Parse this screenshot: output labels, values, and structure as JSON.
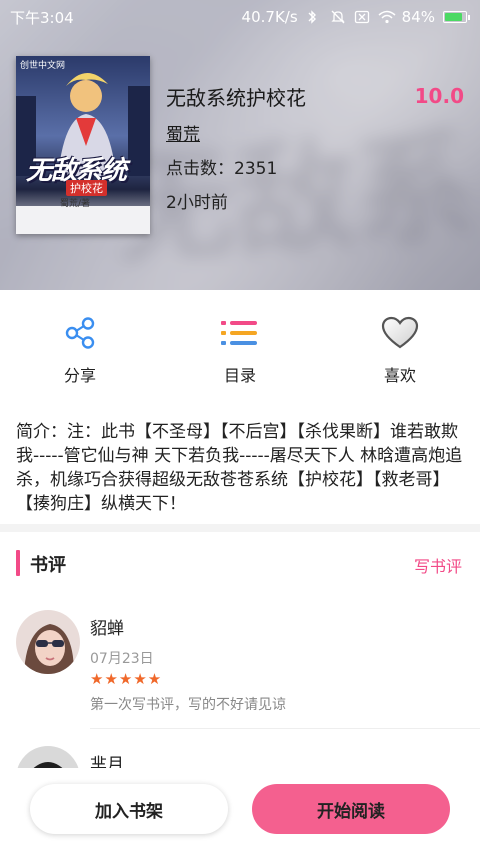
{
  "status_bar": {
    "time": "下午3:04",
    "speed": "40.7K/s",
    "battery": "84%"
  },
  "book": {
    "cover_brand": "创世中文网",
    "cover_title": "无敌系统",
    "cover_subtitle": "护校花",
    "cover_author": "蜀荒/著",
    "title": "无敌系统护校花",
    "score": "10.0",
    "author": "蜀荒",
    "clicks": "点击数：2351",
    "updated": "2小时前"
  },
  "actions": [
    {
      "label": "分享",
      "icon": "share-icon"
    },
    {
      "label": "目录",
      "icon": "catalog-icon"
    },
    {
      "label": "喜欢",
      "icon": "heart-icon"
    }
  ],
  "intro": "简介：注：此书【不圣母】【不后宫】【杀伐果断】谁若敢欺我-----管它仙与神 天下若负我-----屠尽天下人 林晗遭高炮追杀，机缘巧合获得超级无敌苍苍系统【护校花】【救老哥】【揍狗庄】纵横天下！",
  "reviews": {
    "title": "书评",
    "write_label": "写书评",
    "items": [
      {
        "name": "貂蝉",
        "date": "07月23日",
        "stars": "★★★★★",
        "text": "第一次写书评，写的不好请见谅"
      },
      {
        "name": "芈月"
      }
    ]
  },
  "bottom": {
    "add_shelf": "加入书架",
    "start_read": "开始阅读"
  },
  "colors": {
    "accent": "#f24a87",
    "read_button": "#f4608f",
    "stars": "#f0682a"
  }
}
